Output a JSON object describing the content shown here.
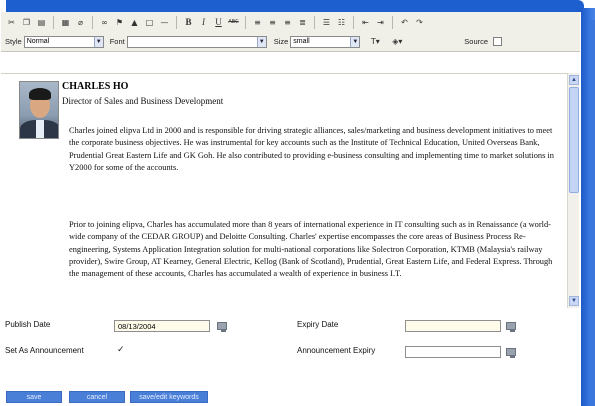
{
  "toolbar": {
    "row1_icons": [
      "cut-icon",
      "copy-icon",
      "paste-icon",
      "table-icon",
      "eraser-icon",
      "link-icon",
      "anchor-icon",
      "image-icon",
      "box-icon",
      "horizontal-rule-icon"
    ],
    "bold": "B",
    "italic": "I",
    "underline": "U",
    "strike": "ABC",
    "style_label": "Style",
    "style_value": "Normal",
    "font_label": "Font",
    "font_value": "",
    "size_label": "Size",
    "size_value": "small",
    "source_label": "Source"
  },
  "profile": {
    "name": "CHARLES HO",
    "role": "Director of Sales and Business Development",
    "paragraph1": "Charles joined elipva Ltd in 2000 and is responsible for driving strategic alliances, sales/marketing and business development initiatives to meet the corporate business objectives. He was instrumental for key accounts such as the Institute of Technical Education, United Overseas Bank, Prudential Great Eastern Life and GK Goh. He also contributed to providing e-business consulting and implementing time to market solutions in Y2000 for some of the accounts.",
    "paragraph2": "Prior to joining elipva, Charles has accumulated more than 8 years of international experience in IT consulting such as in Renaissance (a world-wide company of the CEDAR GROUP) and Deloitte Consulting. Charles' expertise encompasses the core areas of Business Process Re-engineering, Systems Application Integration solution for multi-national corporations like Solectron Corporation, KTMB (Malaysia's railway provider), Swire Group, AT Kearney, General Electric, Kellog (Bank of Scotland), Prudential, Great Eastern Life, and Federal Express. Through the management of these accounts, Charles has accumulated a wealth of experience in business I.T."
  },
  "form": {
    "publish_date_label": "Publish Date",
    "publish_date_value": "08/13/2004",
    "expiry_date_label": "Expiry Date",
    "expiry_date_value": "",
    "announcement_label": "Set As Announcement",
    "announcement_checked": "✓",
    "announcement_expiry_label": "Announcement Expiry",
    "announcement_expiry_value": ""
  },
  "buttons": {
    "save": "save",
    "cancel": "cancel",
    "save_keywords": "save/edit keywords"
  },
  "colors": {
    "frame_blue": "#1e5fd0",
    "button_blue": "#4a7fd8"
  }
}
